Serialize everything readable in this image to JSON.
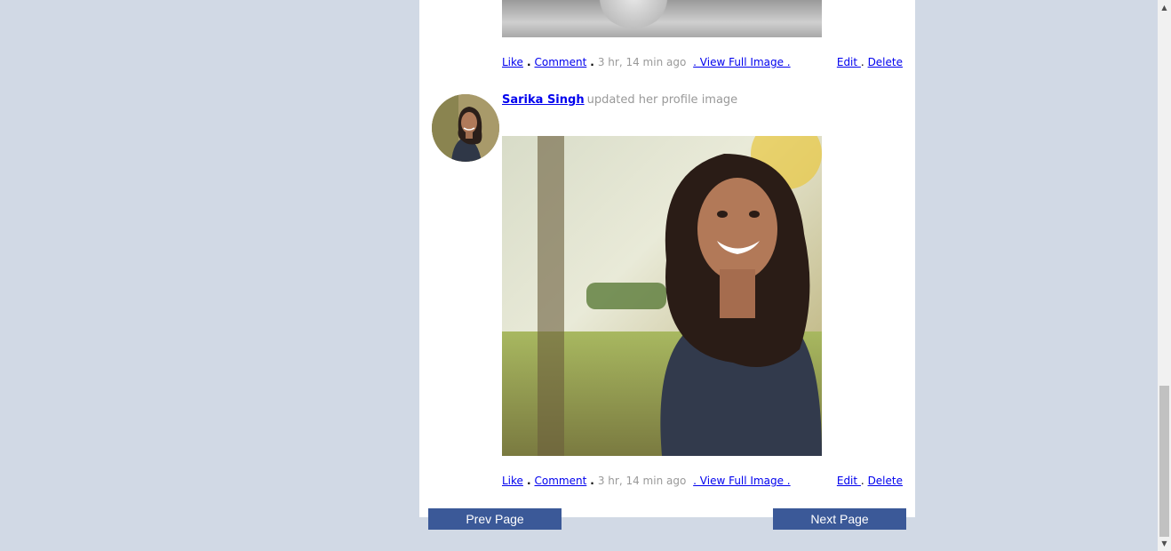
{
  "previous_post": {
    "actions": {
      "like": "Like",
      "comment": "Comment",
      "time": "3 hr, 14 min ago",
      "view_full": ". View Full Image .",
      "edit": "Edit ",
      "delete": "Delete"
    }
  },
  "post": {
    "author": "Sarika Singh",
    "status": "updated her profile image",
    "actions": {
      "like": "Like",
      "comment": "Comment",
      "time": "3 hr, 14 min ago",
      "view_full": ". View Full Image .",
      "edit": "Edit ",
      "delete": "Delete"
    }
  },
  "pagination": {
    "prev_label": "Prev Page",
    "next_label": "Next Page"
  },
  "colors": {
    "background": "#d1d9e5",
    "button": "#3b5998",
    "link": "#0000ee"
  }
}
